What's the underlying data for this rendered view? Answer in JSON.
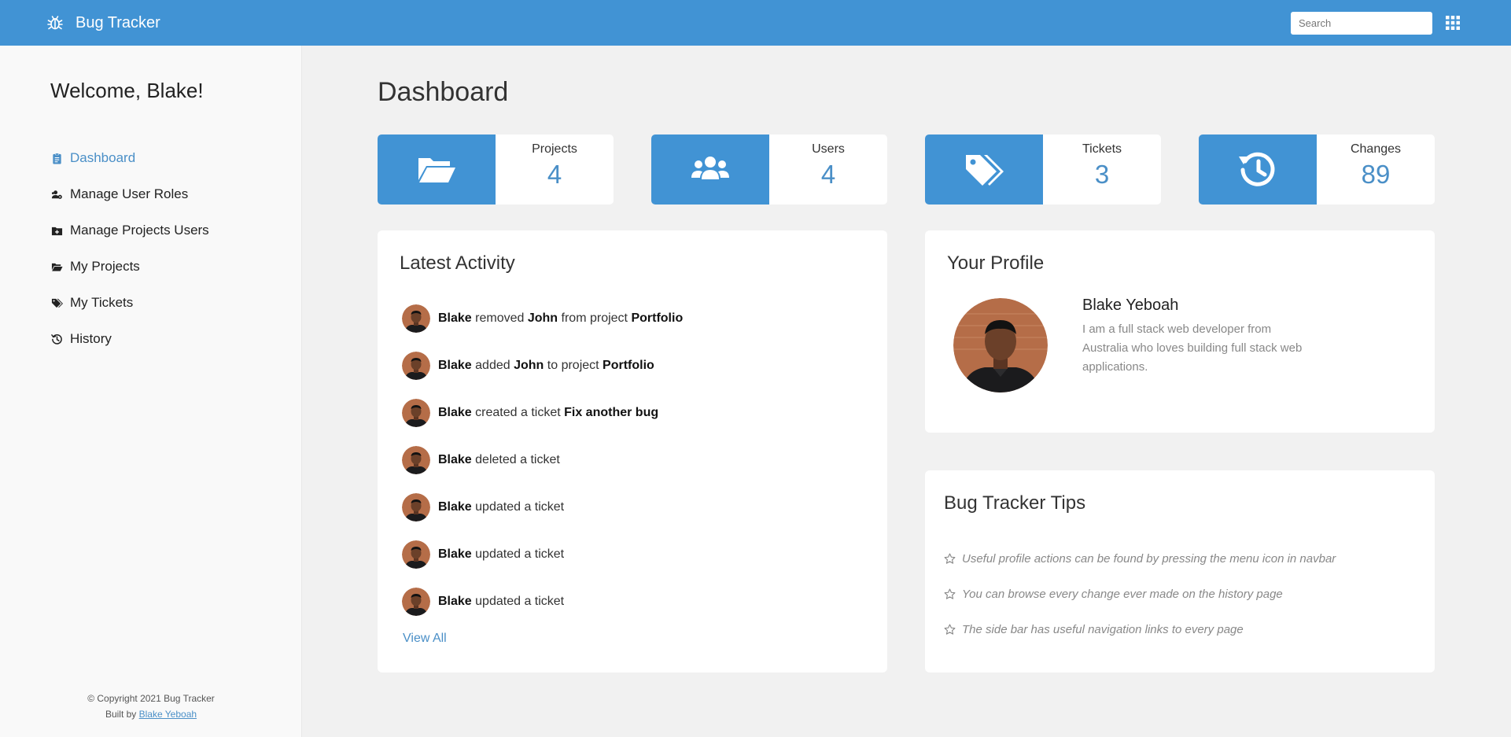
{
  "navbar": {
    "brand": "Bug Tracker",
    "brand_icon": "bug-icon",
    "search_placeholder": "Search",
    "apps_icon": "grid-menu-icon"
  },
  "sidebar": {
    "welcome": "Welcome, Blake!",
    "items": [
      {
        "label": "Dashboard",
        "icon": "clipboard-icon",
        "active": true
      },
      {
        "label": "Manage User Roles",
        "icon": "users-cog-icon",
        "active": false
      },
      {
        "label": "Manage Projects Users",
        "icon": "folder-plus-icon",
        "active": false
      },
      {
        "label": "My Projects",
        "icon": "folder-open-icon",
        "active": false
      },
      {
        "label": "My Tickets",
        "icon": "tags-icon",
        "active": false
      },
      {
        "label": "History",
        "icon": "history-icon",
        "active": false
      }
    ],
    "footer": {
      "copyright": "© Copyright 2021 Bug Tracker",
      "built_by_prefix": "Built by",
      "author_link": "Blake Yeboah"
    }
  },
  "main": {
    "title": "Dashboard",
    "stats": [
      {
        "label": "Projects",
        "value": "4",
        "icon": "folder-open-icon"
      },
      {
        "label": "Users",
        "value": "4",
        "icon": "users-icon"
      },
      {
        "label": "Tickets",
        "value": "3",
        "icon": "tags-icon"
      },
      {
        "label": "Changes",
        "value": "89",
        "icon": "history-icon"
      }
    ],
    "activity": {
      "title": "Latest Activity",
      "items": [
        {
          "user": "Blake",
          "action": "removed",
          "target": "John",
          "connector": "from project",
          "object": "Portfolio"
        },
        {
          "user": "Blake",
          "action": "added",
          "target": "John",
          "connector": "to project",
          "object": "Portfolio"
        },
        {
          "user": "Blake",
          "action": "created a ticket",
          "target": "Fix another bug",
          "connector": "",
          "object": ""
        },
        {
          "user": "Blake",
          "action": "deleted a ticket",
          "target": "",
          "connector": "",
          "object": ""
        },
        {
          "user": "Blake",
          "action": "updated a ticket",
          "target": "",
          "connector": "",
          "object": ""
        },
        {
          "user": "Blake",
          "action": "updated a ticket",
          "target": "",
          "connector": "",
          "object": ""
        },
        {
          "user": "Blake",
          "action": "updated a ticket",
          "target": "",
          "connector": "",
          "object": ""
        }
      ],
      "view_all": "View All"
    },
    "profile": {
      "title": "Your Profile",
      "name": "Blake Yeboah",
      "bio": "I am a full stack web developer from Australia who loves building full stack web applications."
    },
    "tips": {
      "title": "Bug Tracker Tips",
      "items": [
        "Useful profile actions can be found by pressing the menu icon in navbar",
        "You can browse every change ever made on the history page",
        "The side bar has useful navigation links to every page"
      ]
    }
  },
  "colors": {
    "accent": "#4193d4",
    "link": "#4a8fc7",
    "background": "#f1f1f1",
    "sidebar_bg": "#f9f9f9"
  }
}
